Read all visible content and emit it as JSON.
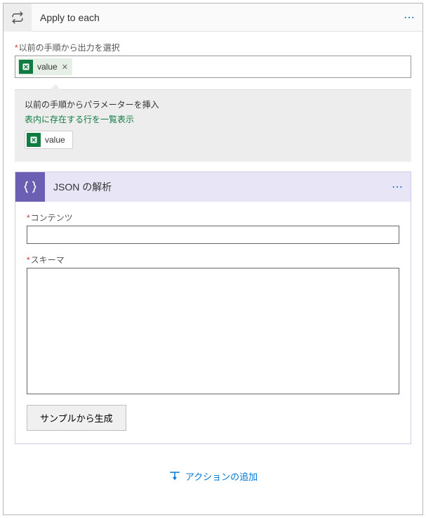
{
  "outer": {
    "title": "Apply to each",
    "menu_label": "⋯",
    "select_output_label": "以前の手順から出力を選択",
    "token": {
      "name": "value"
    },
    "dyn": {
      "title": "以前の手順からパラメーターを挿入",
      "subtitle": "表内に存在する行を一覧表示",
      "option": {
        "name": "value"
      }
    }
  },
  "inner": {
    "title": "JSON の解析",
    "menu_label": "⋯",
    "content_label": "コンテンツ",
    "content_value": "",
    "schema_label": "スキーマ",
    "schema_value": "",
    "generate_button": "サンプルから生成"
  },
  "footer": {
    "add_action": "アクションの追加"
  }
}
